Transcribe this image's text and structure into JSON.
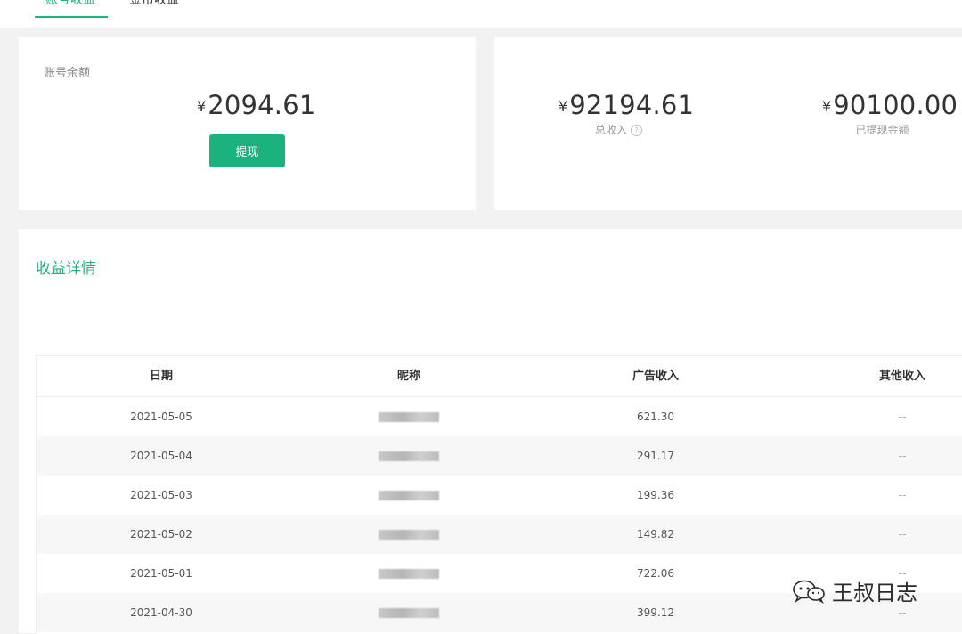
{
  "tabs": [
    {
      "label": "账号收益",
      "active": true
    },
    {
      "label": "金币收益",
      "active": false
    }
  ],
  "balance": {
    "label": "账号余额",
    "currency": "¥",
    "amount": "2094.61",
    "withdraw_label": "提现"
  },
  "summary": {
    "total_income": {
      "currency": "¥",
      "amount": "92194.61",
      "label": "总收入"
    },
    "withdrawn": {
      "currency": "¥",
      "amount": "90100.00",
      "label": "已提现金额"
    }
  },
  "details": {
    "title": "收益详情",
    "columns": [
      "日期",
      "昵称",
      "广告收入",
      "其他收入"
    ],
    "rows": [
      {
        "date": "2021-05-05",
        "ad_income": "621.30",
        "other_income": "--"
      },
      {
        "date": "2021-05-04",
        "ad_income": "291.17",
        "other_income": "--"
      },
      {
        "date": "2021-05-03",
        "ad_income": "199.36",
        "other_income": "--"
      },
      {
        "date": "2021-05-02",
        "ad_income": "149.82",
        "other_income": "--"
      },
      {
        "date": "2021-05-01",
        "ad_income": "722.06",
        "other_income": "--"
      },
      {
        "date": "2021-04-30",
        "ad_income": "399.12",
        "other_income": "--"
      }
    ]
  },
  "watermark": {
    "text": "王叔日志",
    "icon": "wechat-icon"
  },
  "colors": {
    "accent": "#1fb37a",
    "button": "#1ab37e"
  }
}
